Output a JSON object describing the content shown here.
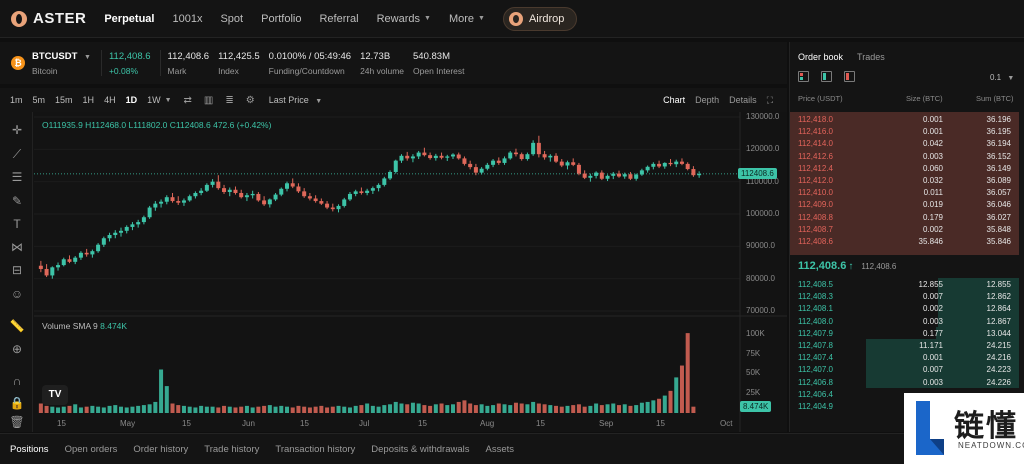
{
  "nav": {
    "brand": "ASTER",
    "items": [
      {
        "label": "Perpetual",
        "active": true
      },
      {
        "label": "1001x"
      },
      {
        "label": "Spot"
      },
      {
        "label": "Portfolio"
      },
      {
        "label": "Referral"
      },
      {
        "label": "Rewards",
        "dropdown": true
      },
      {
        "label": "More",
        "dropdown": true
      }
    ],
    "airdrop": "Airdrop"
  },
  "ticker": {
    "symbol": "BTCUSDT",
    "name": "Bitcoin",
    "last_price": "112,408.6",
    "change": "+0.08%",
    "mark": {
      "value": "112,408.6",
      "label": "Mark"
    },
    "index": {
      "value": "112,425.5",
      "label": "Index"
    },
    "funding": {
      "value": "0.0100% / 05:49:46",
      "label": "Funding/Countdown"
    },
    "volume": {
      "value": "12.73B",
      "label": "24h volume"
    },
    "open_interest": {
      "value": "540.83M",
      "label": "Open Interest"
    }
  },
  "chart_toolbar": {
    "timeframes": [
      "1m",
      "5m",
      "15m",
      "1H",
      "4H",
      "1D",
      "1W"
    ],
    "active_timeframe": "1D",
    "price_type": "Last Price",
    "tabs": [
      "Chart",
      "Depth",
      "Details"
    ],
    "active_tab": "Chart"
  },
  "chart": {
    "ohlc": "O111935.9 H112468.0 L111802.0 C112408.6 472.6 (+0.42%)",
    "volume_label": "Volume SMA 9",
    "volume_value": "8.474K",
    "price_tag": "112408.6",
    "volume_tag": "8.474K",
    "tv_logo": "TV",
    "colors": {
      "up": "#3dc4a8",
      "down": "#e0685a"
    }
  },
  "chart_data": [
    {
      "type": "candlestick",
      "title": "",
      "ylabel": "",
      "y_ticks": [
        "130000.0",
        "120000.0",
        "110000.0",
        "100000.0",
        "90000.0",
        "80000.0",
        "70000.0"
      ],
      "ylim": [
        70000,
        130000
      ],
      "x_ticks": [
        "15",
        "May",
        "15",
        "Jun",
        "15",
        "Jul",
        "15",
        "Aug",
        "15",
        "Sep",
        "15",
        "Oct"
      ],
      "series": [
        {
          "values": [
            [
              84000,
              85500,
              82000,
              83000
            ],
            [
              83000,
              84500,
              80500,
              81000
            ],
            [
              81000,
              83800,
              80000,
              83500
            ],
            [
              83500,
              85000,
              82500,
              84200
            ],
            [
              84200,
              86500,
              83800,
              86000
            ],
            [
              86000,
              87200,
              84800,
              85200
            ],
            [
              85200,
              87000,
              84500,
              86500
            ],
            [
              86500,
              88500,
              85800,
              88000
            ],
            [
              88000,
              89200,
              86800,
              87500
            ],
            [
              87500,
              89000,
              86500,
              88500
            ],
            [
              88500,
              91000,
              88000,
              90500
            ],
            [
              90500,
              93000,
              89800,
              92500
            ],
            [
              92500,
              94200,
              91500,
              93500
            ],
            [
              93500,
              95000,
              92500,
              94200
            ],
            [
              94200,
              95800,
              93000,
              94800
            ],
            [
              94800,
              96500,
              94000,
              96000
            ],
            [
              96000,
              97500,
              95000,
              96800
            ],
            [
              96800,
              98200,
              95800,
              97500
            ],
            [
              97500,
              99500,
              96800,
              99000
            ],
            [
              99000,
              102500,
              98500,
              102000
            ],
            [
              102000,
              104000,
              101000,
              103200
            ],
            [
              103200,
              104500,
              102000,
              103800
            ],
            [
              103800,
              105800,
              103000,
              105200
            ],
            [
              105200,
              106500,
              103500,
              104000
            ],
            [
              104000,
              105500,
              102800,
              103500
            ],
            [
              103500,
              104800,
              102500,
              104200
            ],
            [
              104200,
              106000,
              103800,
              105500
            ],
            [
              105500,
              107000,
              104800,
              106500
            ],
            [
              106500,
              108000,
              105800,
              107200
            ],
            [
              107200,
              109500,
              106800,
              109000
            ],
            [
              109000,
              110800,
              108200,
              110000
            ],
            [
              110000,
              112000,
              107500,
              108000
            ],
            [
              108000,
              109000,
              106200,
              106800
            ],
            [
              106800,
              108200,
              105500,
              107500
            ],
            [
              107500,
              108500,
              106000,
              106500
            ],
            [
              106500,
              107500,
              104800,
              105200
            ],
            [
              105200,
              106500,
              104000,
              105800
            ],
            [
              105800,
              107200,
              104800,
              106200
            ],
            [
              106200,
              106800,
              103800,
              104200
            ],
            [
              104200,
              105500,
              102500,
              103000
            ],
            [
              103000,
              104800,
              102000,
              104500
            ],
            [
              104500,
              106500,
              104000,
              106000
            ],
            [
              106000,
              108200,
              105500,
              107800
            ],
            [
              107800,
              110000,
              107000,
              109500
            ],
            [
              109500,
              111000,
              108000,
              108500
            ],
            [
              108500,
              109500,
              106500,
              107000
            ],
            [
              107000,
              108000,
              105000,
              105500
            ],
            [
              105500,
              106500,
              104200,
              104800
            ],
            [
              104800,
              105800,
              103500,
              104000
            ],
            [
              104000,
              104800,
              102800,
              103200
            ],
            [
              103200,
              104000,
              101500,
              102000
            ],
            [
              102000,
              103200,
              100800,
              101500
            ],
            [
              101500,
              103000,
              100500,
              102500
            ],
            [
              102500,
              105000,
              102000,
              104500
            ],
            [
              104500,
              106800,
              104000,
              106200
            ],
            [
              106200,
              107500,
              105500,
              107000
            ],
            [
              107000,
              108200,
              106000,
              106500
            ],
            [
              106500,
              107800,
              105800,
              107200
            ],
            [
              107200,
              108500,
              106200,
              108000
            ],
            [
              108000,
              109500,
              107000,
              109000
            ],
            [
              109000,
              111500,
              108500,
              111000
            ],
            [
              111000,
              113500,
              110500,
              113000
            ],
            [
              113000,
              116800,
              112500,
              116500
            ],
            [
              116500,
              118500,
              115800,
              118000
            ],
            [
              118000,
              119200,
              116500,
              117200
            ],
            [
              117200,
              118500,
              116000,
              117800
            ],
            [
              117800,
              119500,
              117000,
              119000
            ],
            [
              119000,
              120500,
              117800,
              118200
            ],
            [
              118200,
              119000,
              116800,
              117300
            ],
            [
              117300,
              118600,
              116500,
              118000
            ],
            [
              118000,
              119000,
              116900,
              117400
            ],
            [
              117400,
              118300,
              116400,
              117800
            ],
            [
              117800,
              118800,
              117000,
              118400
            ],
            [
              118400,
              119000,
              116800,
              117200
            ],
            [
              117200,
              117800,
              115000,
              115500
            ],
            [
              115500,
              116500,
              113800,
              114500
            ],
            [
              114500,
              115500,
              112000,
              112800
            ],
            [
              112800,
              114500,
              112200,
              114000
            ],
            [
              114000,
              115800,
              113500,
              115200
            ],
            [
              115200,
              117000,
              114500,
              116500
            ],
            [
              116500,
              117500,
              115200,
              115800
            ],
            [
              115800,
              117800,
              115200,
              117200
            ],
            [
              117200,
              119500,
              116800,
              119000
            ],
            [
              119000,
              120200,
              117800,
              118500
            ],
            [
              118500,
              119000,
              116500,
              117000
            ],
            [
              117000,
              119000,
              116500,
              118500
            ],
            [
              118500,
              122800,
              118000,
              122000
            ],
            [
              122000,
              124200,
              117500,
              118500
            ],
            [
              118500,
              119500,
              116800,
              117500
            ],
            [
              117500,
              118500,
              116200,
              118000
            ],
            [
              118000,
              118800,
              115800,
              116200
            ],
            [
              116200,
              117000,
              114500,
              115000
            ],
            [
              115000,
              116500,
              113800,
              116000
            ],
            [
              116000,
              117200,
              114800,
              115200
            ],
            [
              115200,
              115800,
              112000,
              112500
            ],
            [
              112500,
              113500,
              110800,
              111200
            ],
            [
              111200,
              112500,
              110000,
              111800
            ],
            [
              111800,
              113200,
              111000,
              112800
            ],
            [
              112800,
              113500,
              110500,
              110900
            ],
            [
              110900,
              112200,
              110200,
              111800
            ],
            [
              111800,
              113000,
              110800,
              112500
            ],
            [
              112500,
              113400,
              111200,
              111600
            ],
            [
              111600,
              112800,
              110900,
              112300
            ],
            [
              112300,
              113000,
              110500,
              110900
            ],
            [
              110900,
              112500,
              110300,
              112200
            ],
            [
              112200,
              114000,
              111800,
              113500
            ],
            [
              113500,
              115000,
              112800,
              114600
            ],
            [
              114600,
              116000,
              113800,
              115500
            ],
            [
              115500,
              116500,
              114200,
              114700
            ],
            [
              114700,
              116000,
              114000,
              115800
            ],
            [
              115800,
              117000,
              114800,
              115400
            ],
            [
              115400,
              116800,
              114500,
              116200
            ],
            [
              116200,
              117200,
              115100,
              115500
            ],
            [
              115500,
              116000,
              113500,
              113900
            ],
            [
              113900,
              114800,
              111500,
              112000
            ],
            [
              112000,
              113200,
              111200,
              112400
            ]
          ]
        }
      ]
    },
    {
      "type": "bar",
      "title": "Volume",
      "y_ticks": [
        "100K",
        "75K",
        "50K",
        "25K"
      ],
      "ylim": [
        0,
        110000
      ],
      "series": [
        {
          "values": [
            12,
            9,
            8,
            7,
            8,
            9,
            11,
            7,
            8,
            9,
            8,
            7,
            9,
            10,
            8,
            7,
            8,
            9,
            10,
            11,
            14,
            55,
            34,
            12,
            10,
            9,
            8,
            7,
            9,
            8,
            8,
            7,
            9,
            8,
            7,
            8,
            9,
            7,
            8,
            9,
            10,
            8,
            9,
            8,
            7,
            9,
            8,
            7,
            8,
            9,
            7,
            8,
            9,
            8,
            7,
            9,
            10,
            12,
            9,
            8,
            10,
            11,
            14,
            12,
            11,
            13,
            12,
            10,
            9,
            11,
            12,
            10,
            11,
            14,
            16,
            12,
            10,
            11,
            9,
            10,
            12,
            11,
            10,
            13,
            12,
            11,
            14,
            12,
            11,
            10,
            9,
            8,
            9,
            10,
            11,
            8,
            9,
            12,
            10,
            11,
            12,
            10,
            11,
            9,
            10,
            13,
            14,
            16,
            18,
            22,
            28,
            45,
            60,
            101,
            8
          ]
        }
      ]
    }
  ],
  "orderbook": {
    "tabs": [
      "Order book",
      "Trades"
    ],
    "active_tab": "Order book",
    "step": "0.1",
    "headers": [
      "Price (USDT)",
      "Size (BTC)",
      "Sum (BTC)"
    ],
    "asks": [
      [
        "112,418.0",
        "0.001",
        "36.196"
      ],
      [
        "112,416.0",
        "0.001",
        "36.195"
      ],
      [
        "112,414.0",
        "0.042",
        "36.194"
      ],
      [
        "112,412.6",
        "0.003",
        "36.152"
      ],
      [
        "112,412.4",
        "0.060",
        "36.149"
      ],
      [
        "112,412.0",
        "0.032",
        "36.089"
      ],
      [
        "112,410.0",
        "0.011",
        "36.057"
      ],
      [
        "112,409.0",
        "0.019",
        "36.046"
      ],
      [
        "112,408.8",
        "0.179",
        "36.027"
      ],
      [
        "112,408.7",
        "0.002",
        "35.848"
      ],
      [
        "112,408.6",
        "35.846",
        "35.846"
      ]
    ],
    "mid_price": "112,408.6",
    "mid_arrow": "↑",
    "mark_price": "112,408.6",
    "bids": [
      [
        "112,408.5",
        "12.855",
        "12.855"
      ],
      [
        "112,408.3",
        "0.007",
        "12.862"
      ],
      [
        "112,408.1",
        "0.002",
        "12.864"
      ],
      [
        "112,408.0",
        "0.003",
        "12.867"
      ],
      [
        "112,407.9",
        "0.177",
        "13.044"
      ],
      [
        "112,407.8",
        "11.171",
        "24.215"
      ],
      [
        "112,407.4",
        "0.001",
        "24.216"
      ],
      [
        "112,407.0",
        "0.007",
        "24.223"
      ],
      [
        "112,406.8",
        "0.003",
        "24.226"
      ],
      [
        "112,406.4",
        "",
        ""
      ],
      [
        "112,404.9",
        "",
        ""
      ]
    ]
  },
  "bottom_tabs": [
    "Positions",
    "Open orders",
    "Order history",
    "Trade history",
    "Transaction history",
    "Deposits & withdrawals",
    "Assets"
  ],
  "watermark": {
    "cn": "链懂",
    "en": "NEATDOWN.COM"
  }
}
